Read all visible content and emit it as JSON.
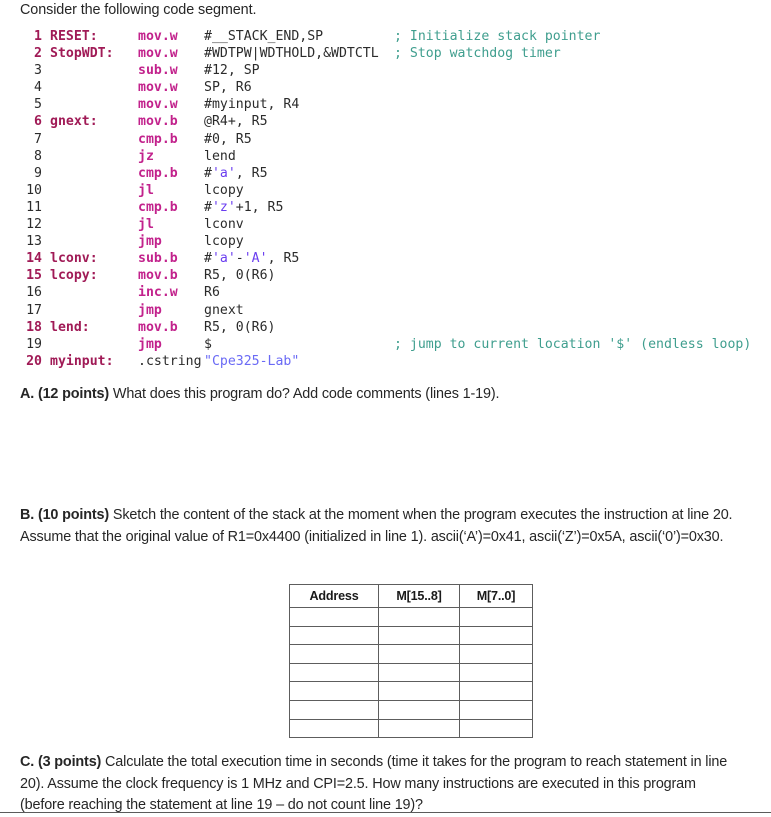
{
  "intro": "Consider the following code segment.",
  "code": {
    "lines": [
      {
        "num": "1",
        "label": "RESET:",
        "mnemonic": "mov.w",
        "operand": "#__STACK_END,SP",
        "comment": "; Initialize stack pointer"
      },
      {
        "num": "2",
        "label": "StopWDT:",
        "mnemonic": "mov.w",
        "operand": "#WDTPW|WDTHOLD,&WDTCTL",
        "comment": "; Stop watchdog timer"
      },
      {
        "num": "3",
        "label": "",
        "mnemonic": "sub.w",
        "operand": "#12, SP",
        "comment": ""
      },
      {
        "num": "4",
        "label": "",
        "mnemonic": "mov.w",
        "operand": "SP, R6",
        "comment": ""
      },
      {
        "num": "5",
        "label": "",
        "mnemonic": "mov.w",
        "operand": "#myinput, R4",
        "comment": ""
      },
      {
        "num": "6",
        "label": "gnext:",
        "mnemonic": "mov.b",
        "operand": "@R4+, R5",
        "comment": ""
      },
      {
        "num": "7",
        "label": "",
        "mnemonic": "cmp.b",
        "operand": "#0, R5",
        "comment": ""
      },
      {
        "num": "8",
        "label": "",
        "mnemonic": "jz",
        "operand": "lend",
        "comment": ""
      },
      {
        "num": "9",
        "label": "",
        "mnemonic": "cmp.b",
        "operand": "#'a', R5",
        "comment": ""
      },
      {
        "num": "10",
        "label": "",
        "mnemonic": "jl",
        "operand": "lcopy",
        "comment": ""
      },
      {
        "num": "11",
        "label": "",
        "mnemonic": "cmp.b",
        "operand": "#'z'+1, R5",
        "comment": ""
      },
      {
        "num": "12",
        "label": "",
        "mnemonic": "jl",
        "operand": "lconv",
        "comment": ""
      },
      {
        "num": "13",
        "label": "",
        "mnemonic": "jmp",
        "operand": "lcopy",
        "comment": ""
      },
      {
        "num": "14",
        "label": "lconv:",
        "mnemonic": "sub.b",
        "operand": "#'a'-'A', R5",
        "comment": ""
      },
      {
        "num": "15",
        "label": "lcopy:",
        "mnemonic": "mov.b",
        "operand": "R5, 0(R6)",
        "comment": ""
      },
      {
        "num": "16",
        "label": "",
        "mnemonic": "inc.w",
        "operand": "R6",
        "comment": ""
      },
      {
        "num": "17",
        "label": "",
        "mnemonic": "jmp",
        "operand": "gnext",
        "comment": ""
      },
      {
        "num": "18",
        "label": "lend:",
        "mnemonic": "mov.b",
        "operand": "R5, 0(R6)",
        "comment": ""
      },
      {
        "num": "19",
        "label": "",
        "mnemonic": "jmp",
        "operand": "$",
        "comment": "; jump to current location '$' (endless loop)"
      },
      {
        "num": "20",
        "label": "myinput:",
        "mnemonic": ".cstring",
        "operand": "\"Cpe325-Lab\"",
        "comment": ""
      }
    ],
    "colors": {
      "line_number": "#a01a56",
      "label": "#a01a56",
      "mnemonic": "#c2228c",
      "operand": "#2b2b2b",
      "char_literal": "#6a3df0",
      "string_literal": "#6a6af5",
      "comment": "#3f9e8e"
    }
  },
  "questions": {
    "a": {
      "lead": "A. (12 points)",
      "text": " What does this program do? Add code comments (lines 1-19)."
    },
    "b": {
      "lead": "B. (10 points)",
      "text": " Sketch the content of the stack at the moment when the program executes the instruction at line 20. Assume that the original value of R1=0x4400 (initialized in line 1).  ascii(‘A’)=0x41, ascii(‘Z’)=0x5A, ascii(‘0’)=0x30."
    },
    "c": {
      "lead": "C. (3 points)",
      "text": " Calculate the total execution time in seconds (time it takes for the program to reach statement in line 20).  Assume the clock frequency is 1 MHz and CPI=2.5.  How many instructions are executed in this program (before reaching the statement at line 19 – do not count line 19)?"
    }
  },
  "stack_table": {
    "headers": [
      "Address",
      "M[15..8]",
      "M[7..0]"
    ],
    "rows": [
      [
        "",
        "",
        ""
      ],
      [
        "",
        "",
        ""
      ],
      [
        "",
        "",
        ""
      ],
      [
        "",
        "",
        ""
      ],
      [
        "",
        "",
        ""
      ],
      [
        "",
        "",
        ""
      ],
      [
        "",
        "",
        ""
      ]
    ]
  }
}
